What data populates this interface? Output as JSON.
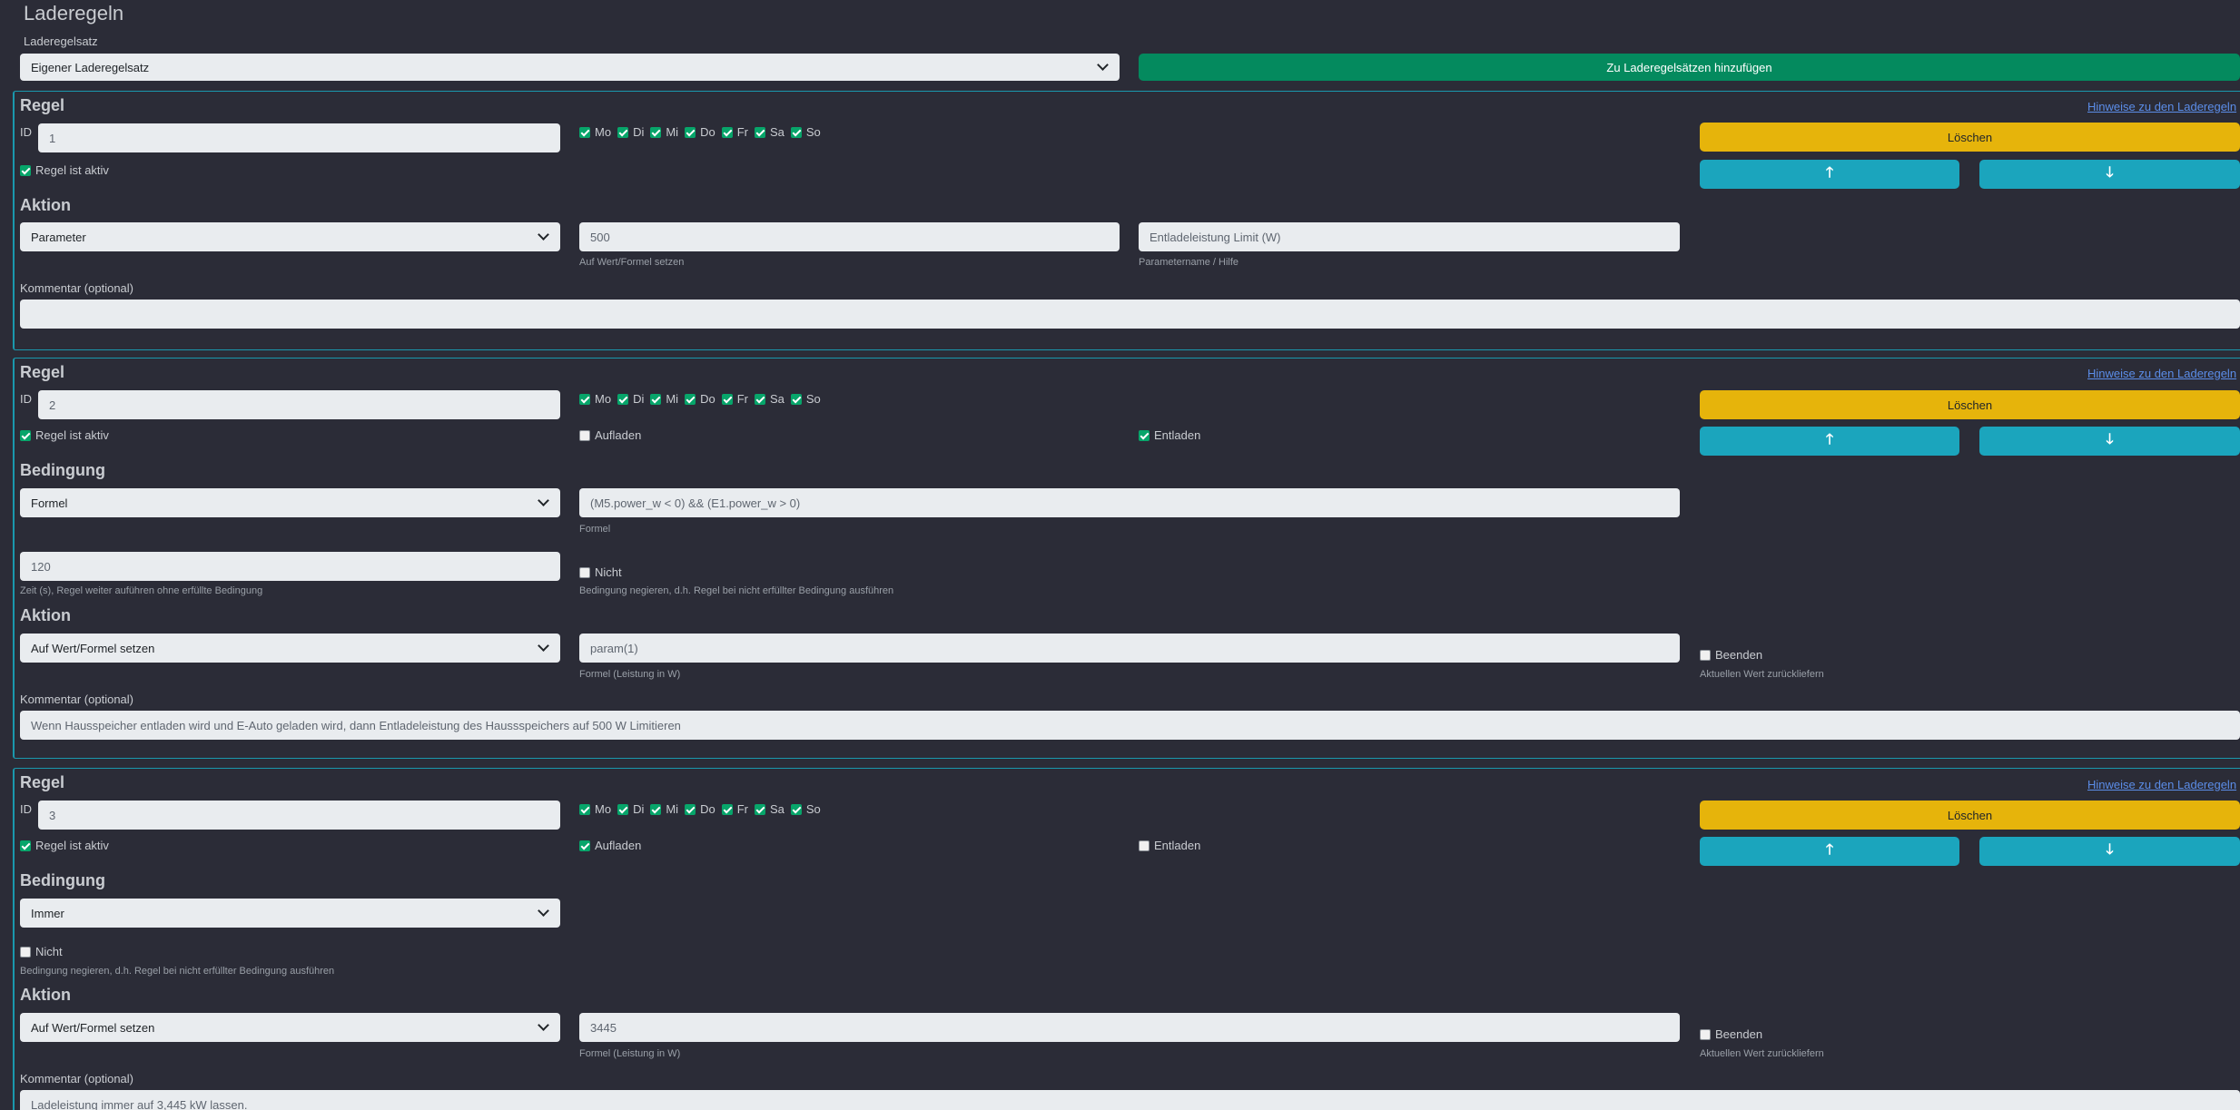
{
  "page": {
    "title": "Laderegeln",
    "ruleset_label": "Laderegelsatz",
    "ruleset_value": "Eigener Laderegelsatz",
    "add_button": "Zu Laderegelsätzen hinzufügen"
  },
  "common": {
    "regel_heading": "Regel",
    "id_label": "ID",
    "active_label": "Regel ist aktiv",
    "hint_link": "Hinweise zu den Laderegeln",
    "delete_label": "Löschen",
    "up_icon": "arrow-up-icon",
    "down_icon": "arrow-down-icon",
    "aktion_heading": "Aktion",
    "bedingung_heading": "Bedingung",
    "comment_label": "Kommentar (optional)",
    "aufladen": "Aufladen",
    "entladen": "Entladen",
    "nicht_label": "Nicht",
    "nicht_hint": "Bedingung negieren, d.h. Regel bei nicht erfüllter Bedingung ausführen",
    "beenden_label": "Beenden",
    "beenden_hint": "Aktuellen Wert zurückliefern",
    "days": [
      "Mo",
      "Di",
      "Mi",
      "Do",
      "Fr",
      "Sa",
      "So"
    ]
  },
  "rules": [
    {
      "id": "1",
      "action_type": "Parameter",
      "value": "500",
      "value_hint": "Auf Wert/Formel setzen",
      "param_name": "Entladeleistung Limit (W)",
      "param_hint": "Parametername / Hilfe",
      "comment": ""
    },
    {
      "id": "2",
      "condition_type": "Formel",
      "formula": "(M5.power_w < 0) && (E1.power_w > 0)",
      "formula_hint": "Formel",
      "time_value": "120",
      "time_hint": "Zeit (s), Regel weiter auführen ohne erfüllte Bedingung",
      "action_type": "Auf Wert/Formel setzen",
      "value": "param(1)",
      "value_hint": "Formel (Leistung in W)",
      "comment": "Wenn Hausspeicher entladen wird und E-Auto geladen wird, dann Entladeleistung des Haussspeichers auf 500 W Limitieren"
    },
    {
      "id": "3",
      "condition_type": "Immer",
      "action_type": "Auf Wert/Formel setzen",
      "value": "3445",
      "value_hint": "Formel (Leistung in W)",
      "comment": "Ladeleistung immer auf 3,445 kW lassen."
    }
  ]
}
